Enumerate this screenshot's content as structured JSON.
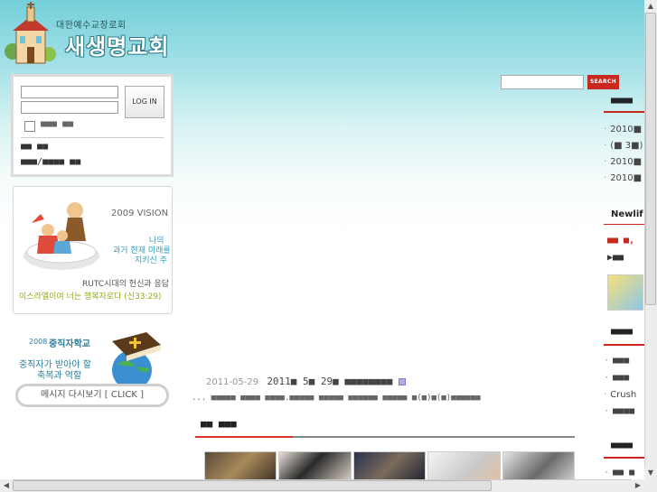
{
  "header": {
    "subtitle": "대한예수교장로회",
    "church_name": "새생명교회"
  },
  "login": {
    "button_label": "LOG IN",
    "remember_label": "■■■ ■■",
    "link1": "■■ ■■",
    "link2": "■■■/■■■■ ■■"
  },
  "vision_banner": {
    "year_title": "2009 VISION",
    "line1": "나의",
    "line2": "과거 현재 미래를",
    "line3": "지키신 주",
    "line4": "RUTC시대의 헌신과 응답",
    "verse": "이스라엘이여 너는 행복자로다 (신33:29)"
  },
  "school_banner": {
    "title_year": "2008",
    "title": "중직자학교",
    "line1": "중직자가 받아야 할",
    "line2": "축복과 역할",
    "button_label": "메시지 다시보기 [ CLICK ]"
  },
  "search": {
    "button_label": "SEARCH",
    "placeholder": ""
  },
  "main": {
    "news_date": "2011-05-29",
    "news_text": "2011■ 5■ 29■ ■■■■■■■■ ",
    "dots_text": "... ■■■■■ ■■■■ ■■■■.■■■■■ ■■■■■ ■■■■■■ ■■■■■ ■(■)■(■)■■■■■■",
    "section_title": "■■ ■■■"
  },
  "right": {
    "head1": "■■■■",
    "items1": [
      "2010■",
      "(■ 3■)",
      "2010■",
      "2010■"
    ],
    "head2": "Newlif",
    "sub2": "■■ ■,",
    "sub2b": "▶■■",
    "head3": "■■■■",
    "items3": [
      "■■■",
      "■■■",
      "Crush",
      "■■■■"
    ],
    "head4": "■■■■",
    "items4": [
      "■■ ■"
    ]
  },
  "colors": {
    "accent_red": "#c8281d",
    "sky_top": "#74cfd9"
  }
}
